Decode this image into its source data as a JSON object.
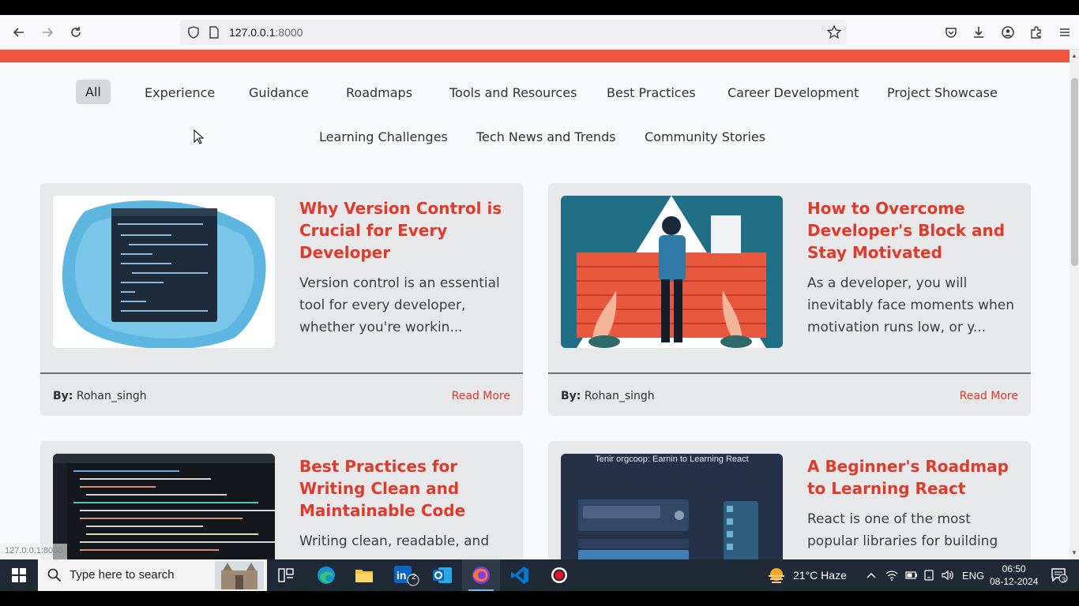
{
  "browser": {
    "url_host": "127.0.0.1",
    "url_port": ":8000",
    "status_url": "127.0.0.1:8000"
  },
  "filters": {
    "row1": [
      "All",
      "Experience",
      "Guidance",
      "Roadmaps",
      "Tools and Resources",
      "Best Practices",
      "Career Development",
      "Project Showcase"
    ],
    "row2": [
      "Learning Challenges",
      "Tech News and Trends",
      "Community Stories"
    ],
    "active": "All"
  },
  "posts": [
    {
      "title": "Why Version Control is Crucial for Every Developer",
      "excerpt": "Version control is an essential tool for every developer, whether you're workin...",
      "author_label": "By:",
      "author": "Rohan_singh",
      "read_more": "Read More",
      "image_icon": "code-editor-illustration"
    },
    {
      "title": "How to Overcome Developer's Block and Stay Motivated",
      "excerpt": "As a developer, you will inevitably face moments when motivation runs low, or y...",
      "author_label": "By:",
      "author": "Rohan_singh",
      "read_more": "Read More",
      "image_icon": "developer-at-wall-illustration"
    },
    {
      "title": "Best Practices for Writing Clean and Maintainable Code",
      "excerpt": "Writing clean, readable, and",
      "image_icon": "dark-code-screenshot"
    },
    {
      "title": "A Beginner's Roadmap to Learning React",
      "excerpt": "React is one of the most popular libraries for building",
      "image_icon": "react-roadmap-illustration",
      "image_caption": "Tenir orgcoop: Earnin to Learning React"
    }
  ],
  "taskbar": {
    "search_placeholder": "Type here to search",
    "weather": "21°C  Haze",
    "language": "ENG",
    "time": "06:50",
    "date": "08-12-2024",
    "notification_count": "3",
    "linkedin_badge": "2"
  },
  "colors": {
    "accent": "#e03a2b",
    "band": "#f2553f",
    "card_bg": "#e7e8ea",
    "taskbar": "#1f2a36"
  }
}
